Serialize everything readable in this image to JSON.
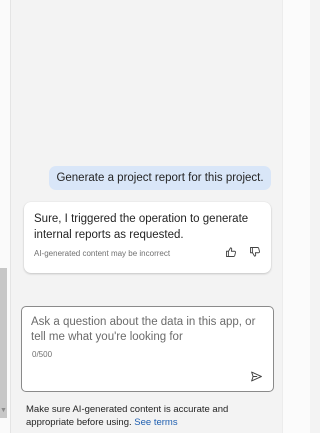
{
  "conversation": {
    "user_message": "Generate a project report for this project.",
    "ai_response": "Sure, I triggered the operation to generate internal reports as requested.",
    "ai_disclaimer": "AI-generated content may be incorrect"
  },
  "feedback": {
    "thumbs_up_icon": "thumbs-up-icon",
    "thumbs_down_icon": "thumbs-down-icon"
  },
  "composer": {
    "placeholder": "Ask a question about the data in this app, or tell me what you're looking for",
    "value": "",
    "char_count": "0/500",
    "send_icon": "send-icon"
  },
  "footer": {
    "note": "Make sure AI-generated content is accurate and appropriate before using.",
    "terms_link": "See terms"
  },
  "colors": {
    "user_bubble": "#d9e6f8",
    "pane_background": "#f3f3f3",
    "link": "#1f5fb0"
  }
}
